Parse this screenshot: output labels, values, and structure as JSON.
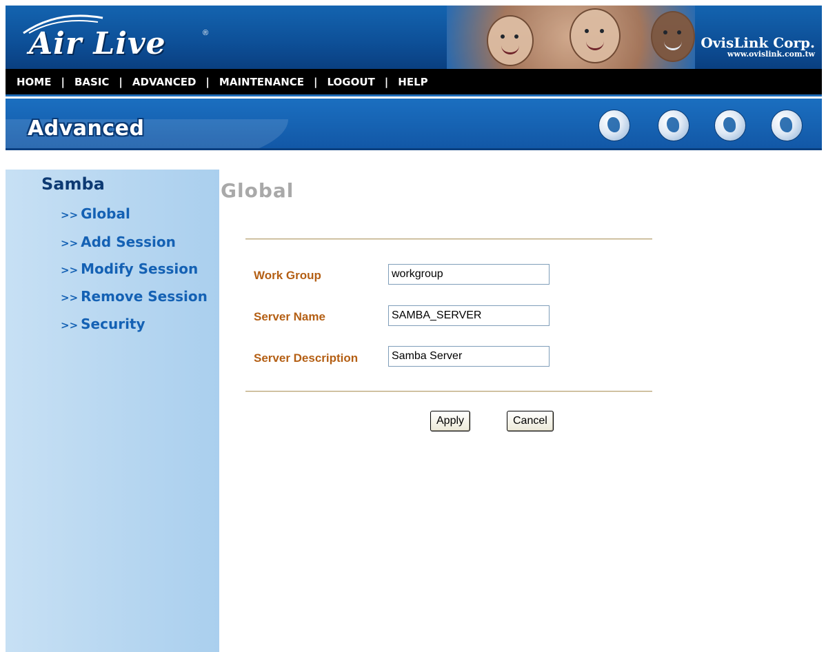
{
  "brand": {
    "logo_text": "Air Live",
    "registered_mark": "®",
    "corp_name": "OvisLink Corp.",
    "corp_url": "www.ovislink.com.tw"
  },
  "nav": {
    "items": [
      "HOME",
      "BASIC",
      "ADVANCED",
      "MAINTENANCE",
      "LOGOUT",
      "HELP"
    ],
    "separator": "|"
  },
  "banner": {
    "title": "Advanced",
    "icons": [
      "globe-icon",
      "globe-icon",
      "globe-icon",
      "globe-icon"
    ]
  },
  "sidebar": {
    "title": "Samba",
    "arrow": ">>",
    "items": [
      {
        "label": "Global"
      },
      {
        "label": "Add Session"
      },
      {
        "label": "Modify Session"
      },
      {
        "label": "Remove Session"
      },
      {
        "label": "Security"
      }
    ]
  },
  "main": {
    "title": "Global",
    "fields": [
      {
        "label": "Work Group",
        "value": "workgroup"
      },
      {
        "label": "Server Name",
        "value": "SAMBA_SERVER"
      },
      {
        "label": "Server Description",
        "value": "Samba Server"
      }
    ],
    "apply_label": "Apply",
    "cancel_label": "Cancel"
  },
  "colors": {
    "header_blue": "#1464b0",
    "nav_black": "#000000",
    "label_orange": "#b45f14",
    "link_blue": "#1461b4",
    "sidebar_blue": "#aacfee",
    "title_gray": "#a9a9a9"
  }
}
